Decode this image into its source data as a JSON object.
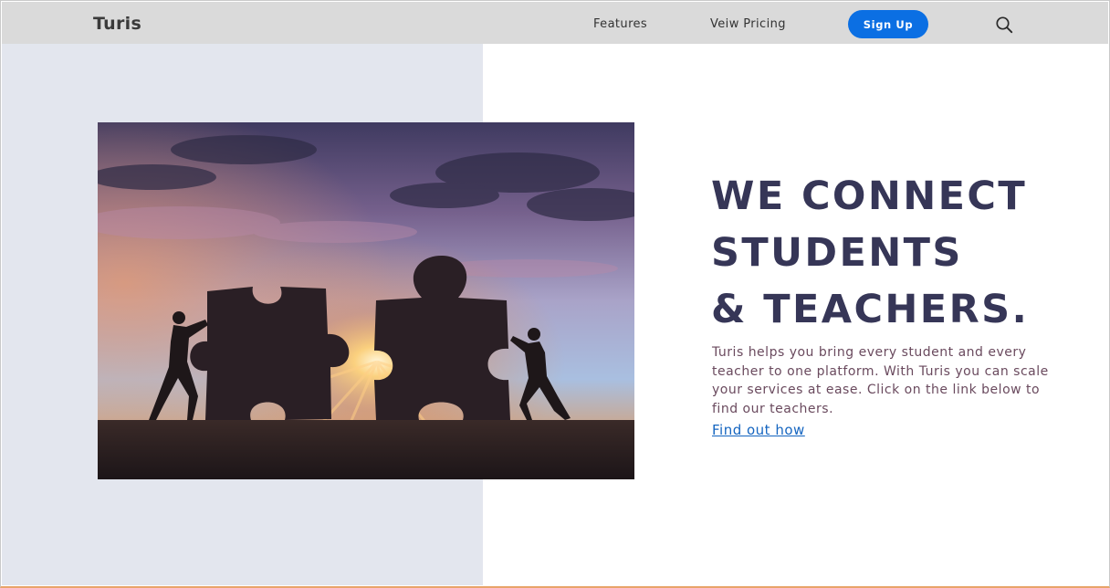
{
  "navbar": {
    "brand": "Turis",
    "links": [
      "Features",
      "Veiw Pricing"
    ],
    "signup_label": "Sign Up",
    "search_icon": "search-icon"
  },
  "hero": {
    "title_lines": [
      "WE CONNECT",
      "STUDENTS",
      "& TEACHERS."
    ],
    "description": "Turis helps you bring every student and every teacher to one platform. With Turis you can scale your services at ease. Click on the link below to find our teachers.",
    "link_label": "Find out how",
    "image_subject": "two people silhouetted pushing giant puzzle pieces together against a sunset sky"
  },
  "colors": {
    "navbar_bg": "#dadada",
    "accent": "#0b6fe3",
    "title": "#363657",
    "left_panel_bg": "#e3e6ee",
    "link": "#1565c0"
  }
}
